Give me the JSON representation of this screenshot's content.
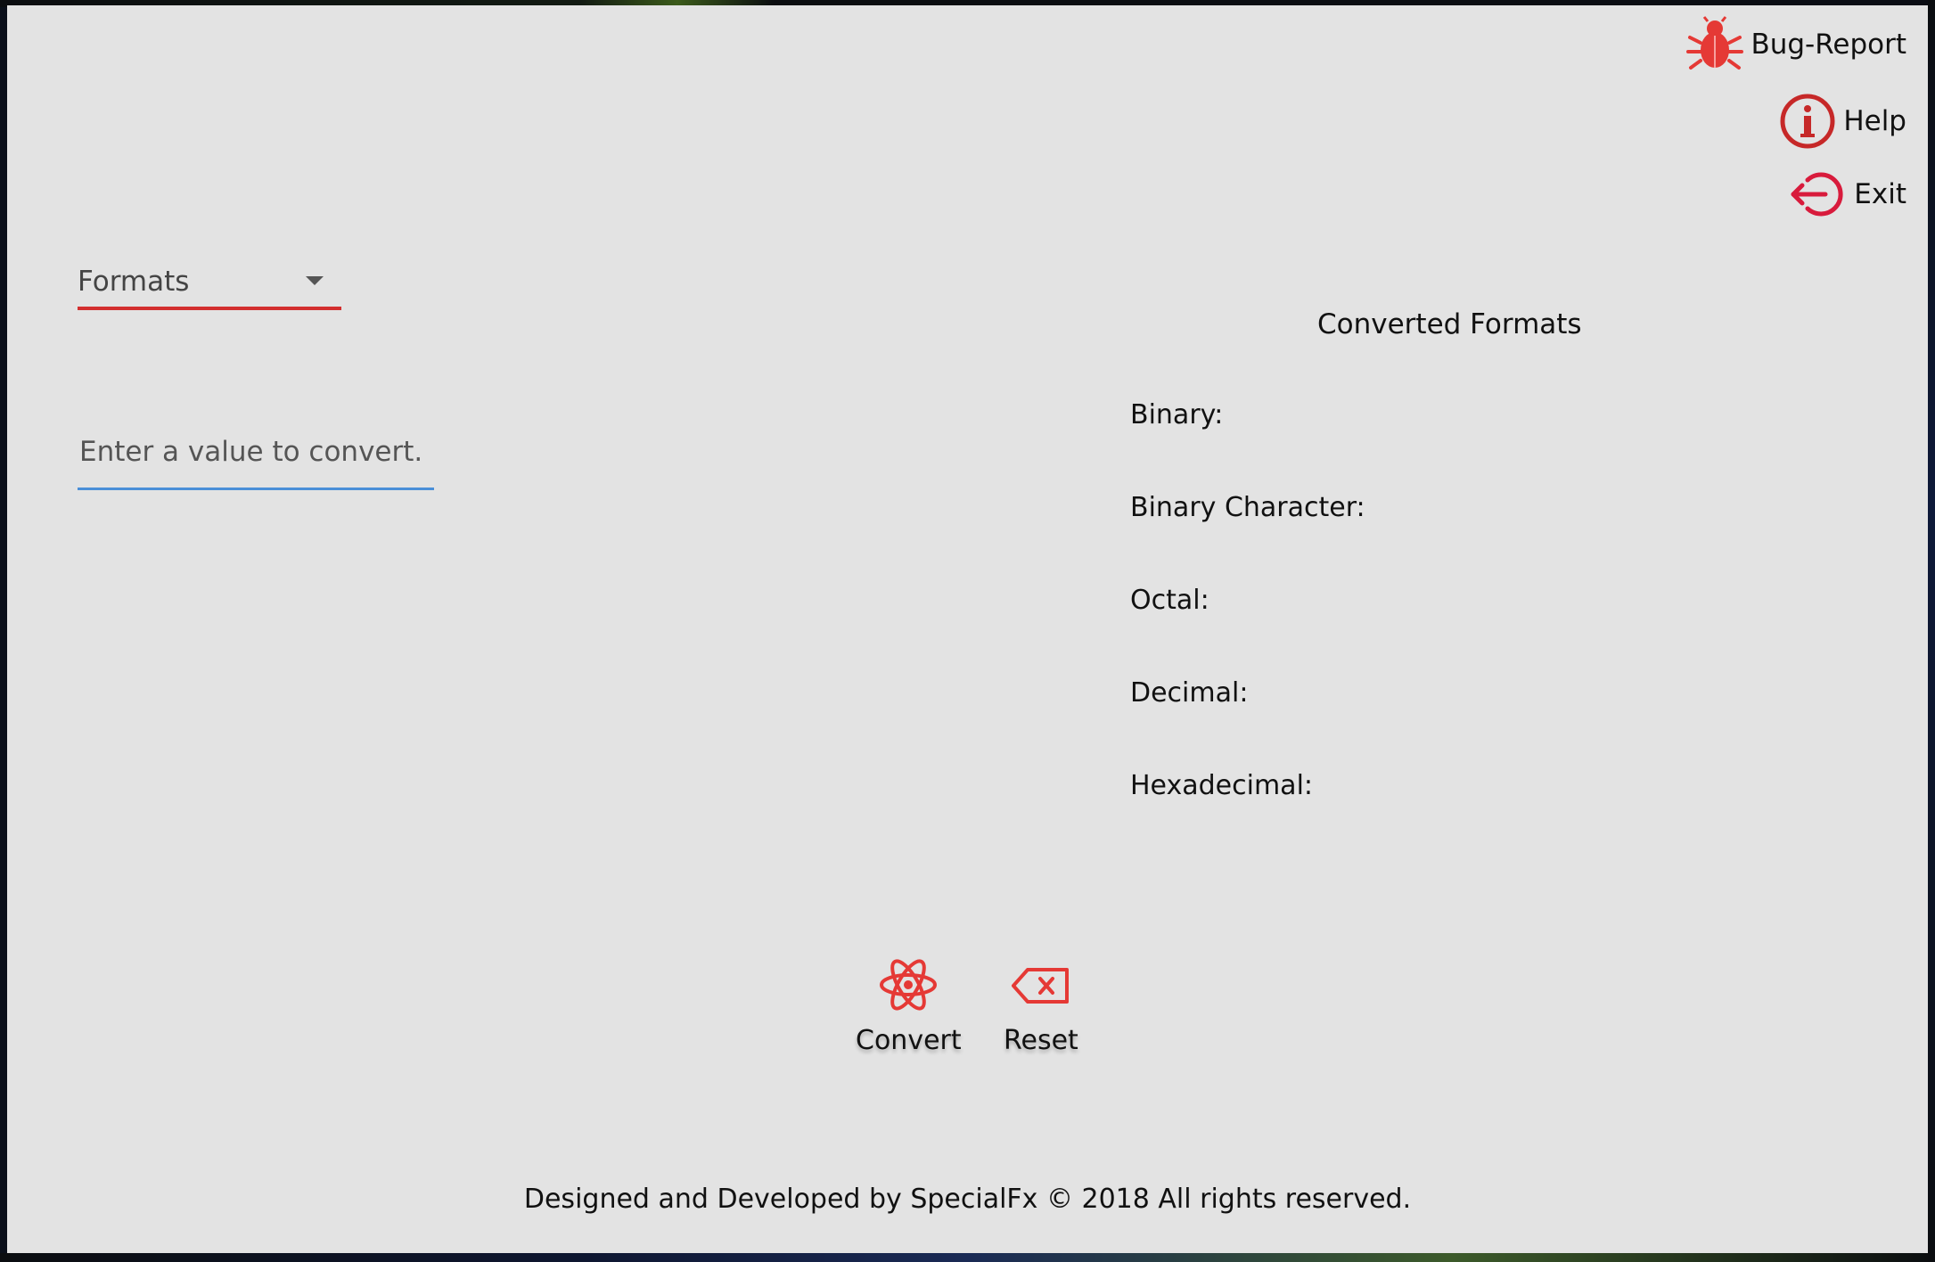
{
  "nav": {
    "bug_report": "Bug-Report",
    "help": "Help",
    "exit": "Exit"
  },
  "formats_select": {
    "label": "Formats"
  },
  "input": {
    "placeholder": "Enter a value to convert.",
    "value": ""
  },
  "results": {
    "title": "Converted Formats",
    "binary_label": "Binary:",
    "binary_value": "",
    "binary_char_label": "Binary Character:",
    "binary_char_value": "",
    "octal_label": "Octal:",
    "octal_value": "",
    "decimal_label": "Decimal:",
    "decimal_value": "",
    "hex_label": "Hexadecimal:",
    "hex_value": ""
  },
  "actions": {
    "convert": "Convert",
    "reset": "Reset"
  },
  "footer": {
    "text": "Designed and Developed by SpecialFx ©  2018 All rights reserved."
  },
  "colors": {
    "accent_red": "#d32f2f",
    "icon_red": "#e53935",
    "input_underline": "#4a8fd8",
    "background": "#e3e3e3"
  },
  "icons": {
    "bug_report": "bug-icon",
    "help": "info-icon",
    "exit": "exit-icon",
    "convert": "atom-icon",
    "reset": "backspace-icon",
    "formats": "caret-down-icon"
  }
}
